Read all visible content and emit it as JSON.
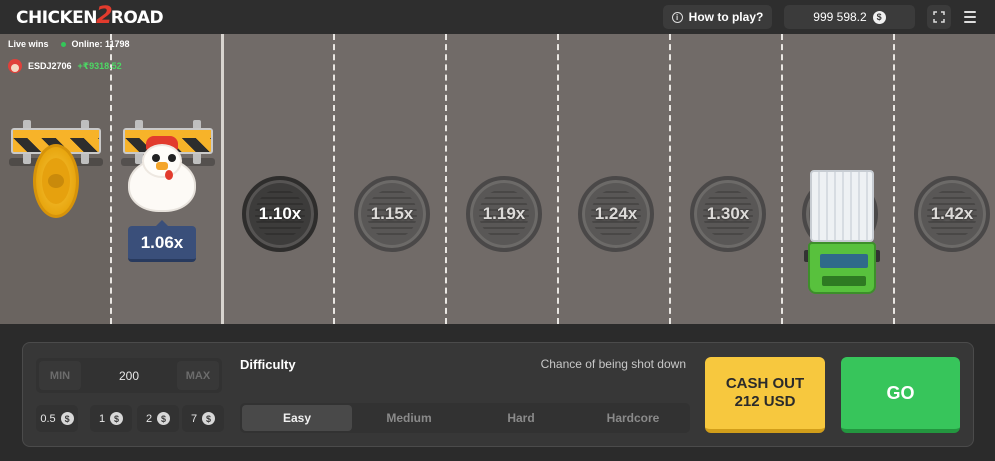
{
  "header": {
    "logo": {
      "part1": "CHICKEN",
      "part2": "2",
      "part3": "ROAD"
    },
    "how_to_play": "How to play?",
    "balance": "999 598.2",
    "currency_symbol": "$"
  },
  "feed": {
    "live_wins": "Live wins",
    "online_label": "Online: 11798",
    "winner_name": "ESDJ2706",
    "winner_amount": "+₹9318.52"
  },
  "road": {
    "current_multiplier": "1.06x",
    "lanes": [
      {
        "multiplier": "1.10x"
      },
      {
        "multiplier": "1.15x"
      },
      {
        "multiplier": "1.19x"
      },
      {
        "multiplier": "1.24x"
      },
      {
        "multiplier": "1.30x"
      },
      {
        "multiplier": "1.42x"
      }
    ]
  },
  "bet": {
    "min_label": "MIN",
    "value": "200",
    "max_label": "MAX",
    "quick_amounts": [
      "0.5",
      "1",
      "2",
      "7"
    ],
    "currency_symbol": "$"
  },
  "difficulty": {
    "label": "Difficulty",
    "chance_label": "Chance of being shot down",
    "options": [
      "Easy",
      "Medium",
      "Hard",
      "Hardcore"
    ],
    "selected": "Easy"
  },
  "actions": {
    "cashout_line1": "CASH OUT",
    "cashout_line2": "212 USD",
    "go": "GO"
  },
  "colors": {
    "road": "#716b68",
    "cashout": "#f7c83e",
    "go": "#37c55b",
    "accent_red": "#e23b2d"
  }
}
